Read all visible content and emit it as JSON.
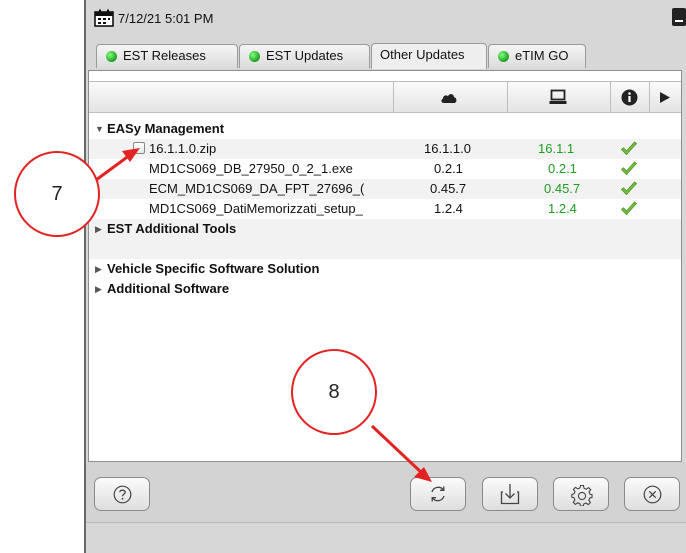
{
  "window": {
    "datetime": "7/12/21 5:01 PM"
  },
  "tabs": [
    {
      "label": "EST Releases",
      "status_color": "#2db52d",
      "active": false
    },
    {
      "label": "EST Updates",
      "status_color": "#2db52d",
      "active": false
    },
    {
      "label": "Other Updates",
      "active": true
    },
    {
      "label": "eTIM GO",
      "status_color": "#2db52d",
      "active": false
    }
  ],
  "columns": {
    "cloud": "cloud-icon",
    "local": "computer-icon",
    "info": "info-icon",
    "more": "play-arrow-icon"
  },
  "tree": {
    "group1": {
      "label": "EASy Management",
      "items": [
        {
          "name": "16.1.1.0.zip",
          "cloud_version": "16.1.1.0",
          "local_version": "16.1.1",
          "status": "check"
        },
        {
          "name": "MD1CS069_DB_27950_0_2_1.exe",
          "cloud_version": "0.2.1",
          "local_version": "0.2.1",
          "status": "check"
        },
        {
          "name": "ECM_MD1CS069_DA_FPT_27696_(",
          "cloud_version": "0.45.7",
          "local_version": "0.45.7",
          "status": "check"
        },
        {
          "name": "MD1CS069_DatiMemorizzati_setup_",
          "cloud_version": "1.2.4",
          "local_version": "1.2.4",
          "status": "check"
        }
      ]
    },
    "group2": {
      "label": "EST Additional Tools"
    },
    "group3": {
      "label": "Vehicle Specific Software Solution"
    },
    "group4": {
      "label": "Additional Software"
    }
  },
  "toolbar": {
    "help": "help-icon",
    "refresh": "refresh-icon",
    "download": "download-icon",
    "settings": "gear-icon",
    "cancel": "cancel-icon"
  },
  "annotations": {
    "callout_7": "7",
    "callout_8": "8",
    "arrow_color": "#e32222"
  },
  "colors": {
    "version_match": "#1e9e1e",
    "status_ok": "#6ec43a"
  }
}
